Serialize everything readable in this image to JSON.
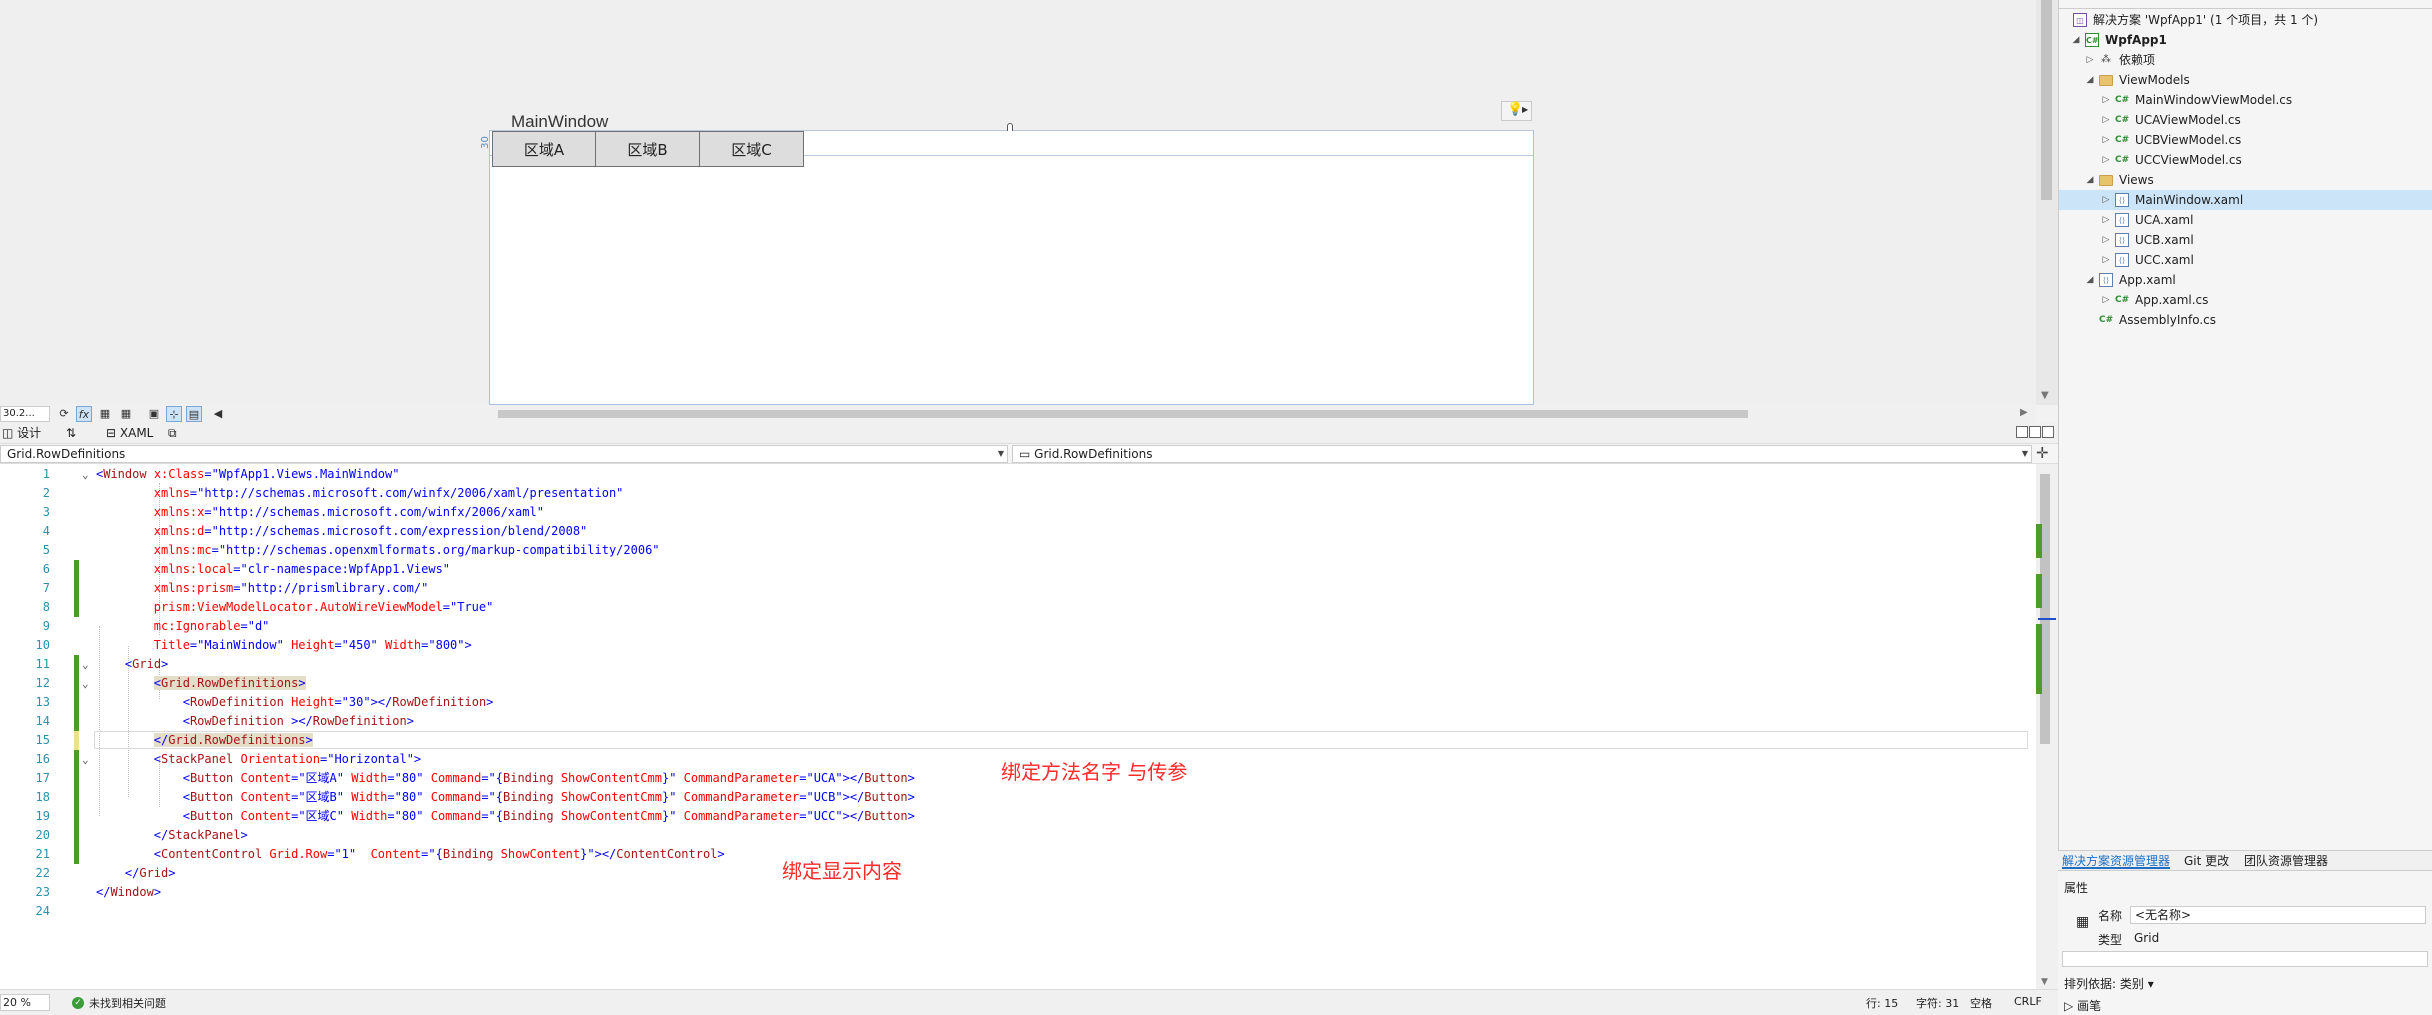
{
  "designer": {
    "window_title": "MainWindow",
    "row_height_marker": "30",
    "buttons": [
      "区域A",
      "区域B",
      "区域C"
    ],
    "zoom": "30.2...",
    "toolbar_icons": [
      "refresh-icon",
      "fx-icon",
      "grid-icon",
      "snap-grid-icon",
      "artboard-icon",
      "snap-lines-icon",
      "annotation-icon"
    ]
  },
  "tabs": {
    "design": "设计",
    "swap": "⇅",
    "xaml": "XAML"
  },
  "nav": {
    "left": "Grid.RowDefinitions",
    "right": "Grid.RowDefinitions"
  },
  "editor": {
    "lines": [
      {
        "n": "1"
      },
      {
        "n": "2"
      },
      {
        "n": "3"
      },
      {
        "n": "4"
      },
      {
        "n": "5"
      },
      {
        "n": "6"
      },
      {
        "n": "7"
      },
      {
        "n": "8"
      },
      {
        "n": "9"
      },
      {
        "n": "10"
      },
      {
        "n": "11"
      },
      {
        "n": "12"
      },
      {
        "n": "13"
      },
      {
        "n": "14"
      },
      {
        "n": "15"
      },
      {
        "n": "16"
      },
      {
        "n": "17"
      },
      {
        "n": "18"
      },
      {
        "n": "19"
      },
      {
        "n": "20"
      },
      {
        "n": "21"
      },
      {
        "n": "22"
      },
      {
        "n": "23"
      },
      {
        "n": "24"
      }
    ],
    "annotations": {
      "binding_method": "绑定方法名字 与传参",
      "binding_content": "绑定显示内容"
    }
  },
  "status": {
    "zoom": "20 %",
    "issues": "未找到相关问题",
    "line": "行: 15",
    "char": "字符: 31",
    "spaces": "空格",
    "eol": "CRLF"
  },
  "solution_explorer": {
    "solution": "解决方案 'WpfApp1' (1 个项目，共 1 个)",
    "project": "WpfApp1",
    "dependencies": "依赖项",
    "viewmodels_folder": "ViewModels",
    "viewmodels": [
      "MainWindowViewModel.cs",
      "UCAViewModel.cs",
      "UCBViewModel.cs",
      "UCCViewModel.cs"
    ],
    "views_folder": "Views",
    "views": [
      "MainWindow.xaml",
      "UCA.xaml",
      "UCB.xaml",
      "UCC.xaml"
    ],
    "app_xaml": "App.xaml",
    "app_xaml_cs": "App.xaml.cs",
    "assembly_info": "AssemblyInfo.cs"
  },
  "se_tabs": [
    "解决方案资源管理器",
    "Git 更改",
    "团队资源管理器"
  ],
  "properties": {
    "title": "属性",
    "name_label": "名称",
    "name_value": "<无名称>",
    "type_label": "类型",
    "type_value": "Grid",
    "sort_label": "排列依据: 类别",
    "brush_label": "画笔"
  },
  "colors": {
    "tag": "#a31515",
    "attribute": "#ff0000",
    "value": "#0000ff",
    "annotation": "#ff2a2a",
    "change_marker": "#4e9a2a",
    "selection": "#cce4f7"
  }
}
